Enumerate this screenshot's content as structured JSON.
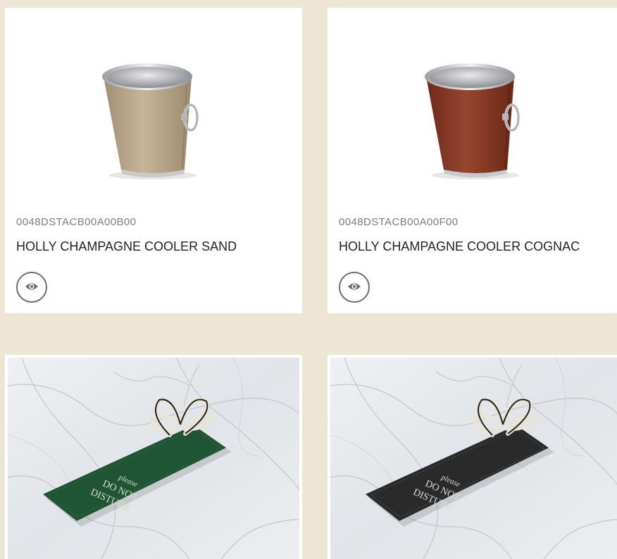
{
  "products": [
    {
      "code": "0048DSTACB00A00B00",
      "title": "HOLLY CHAMPAGNE COOLER SAND",
      "leather_color": "#b7a58a",
      "view_icon": "eye-icon"
    },
    {
      "code": "0048DSTACB00A00F00",
      "title": "HOLLY CHAMPAGNE COOLER COGNAC",
      "leather_color": "#8a3a24",
      "view_icon": "eye-icon"
    }
  ],
  "photos": [
    {
      "tag_color": "#1f5435",
      "tag_text": [
        "please",
        "DO NOT",
        "DISTURB"
      ]
    },
    {
      "tag_color": "#2a2a2a",
      "tag_text": [
        "please",
        "DO NOT",
        "DISTURB"
      ]
    }
  ],
  "colors": {
    "page_background": "#ede6d4",
    "card_background": "#ffffff",
    "code_text": "#7d7d7d",
    "title_text": "#222222"
  }
}
